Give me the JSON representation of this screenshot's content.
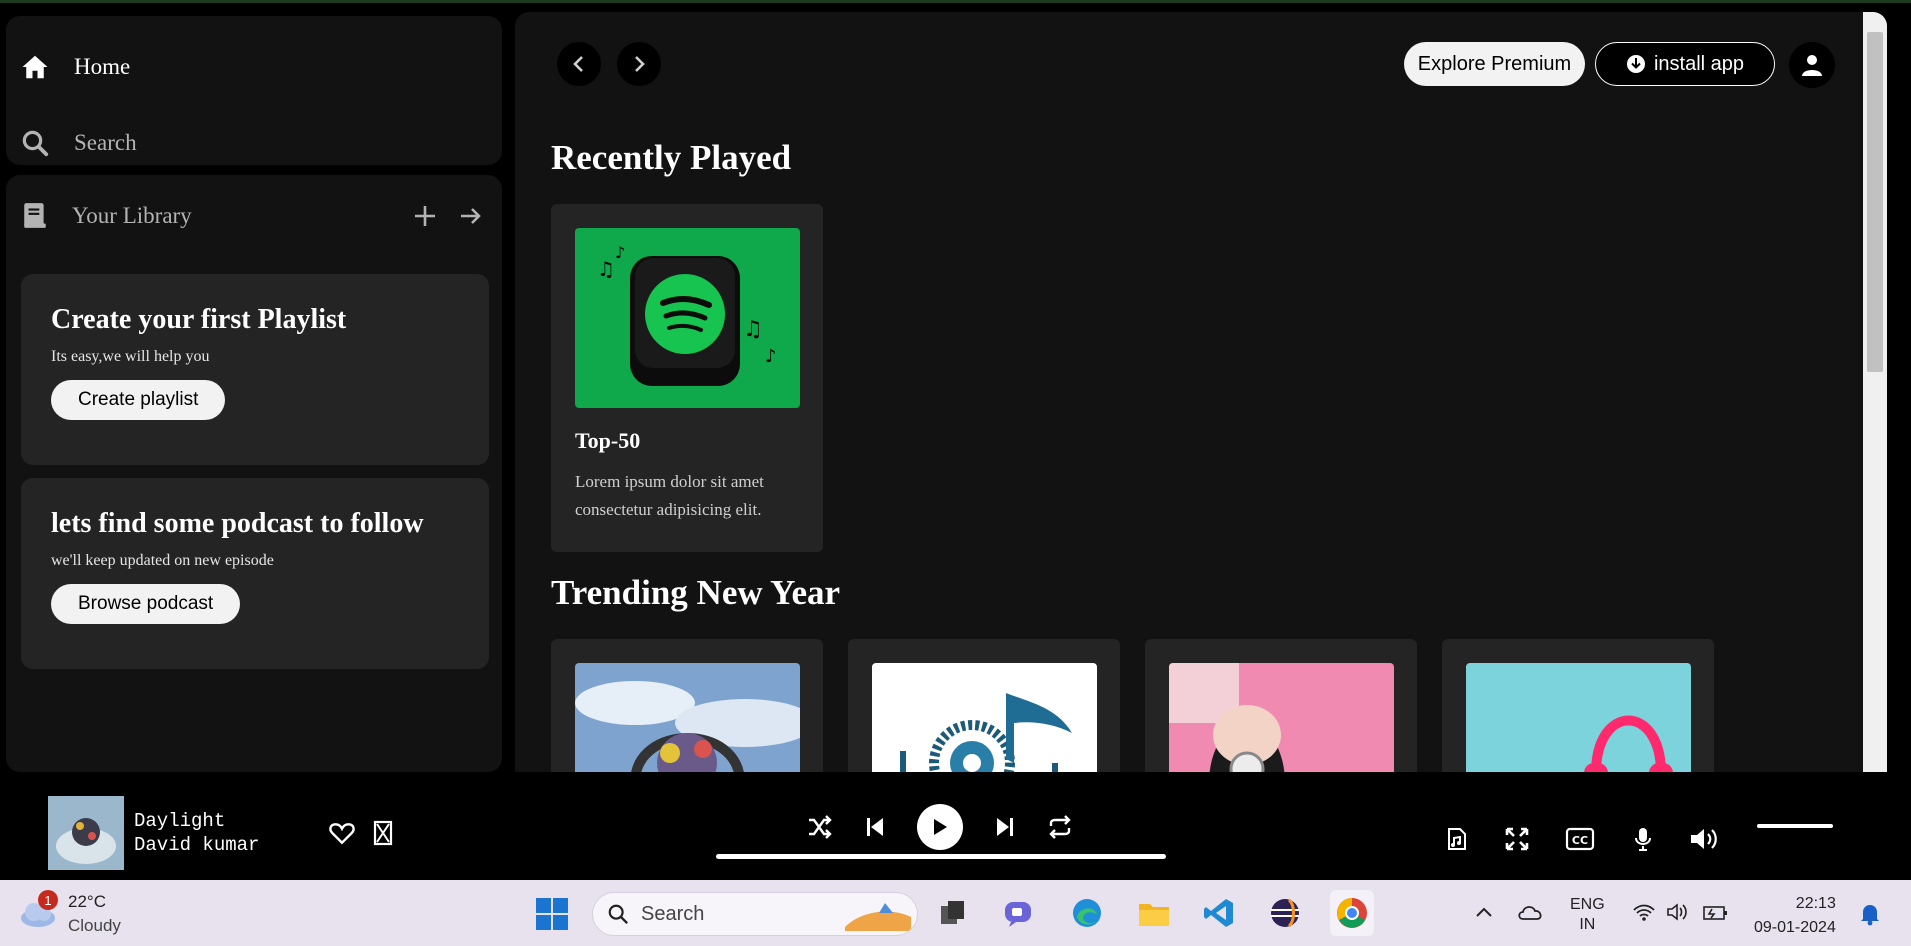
{
  "sidebar": {
    "home_label": "Home",
    "search_label": "Search",
    "library_label": "Your Library",
    "promo_playlist": {
      "title": "Create your first Playlist",
      "subtitle": "Its easy,we will help you",
      "button": "Create playlist"
    },
    "promo_podcast": {
      "title": "lets find some podcast to follow",
      "subtitle": "we'll keep updated on new episode",
      "button": "Browse podcast"
    }
  },
  "header": {
    "explore_label": "Explore Premium",
    "install_label": "install app"
  },
  "sections": {
    "recent_title": "Recently Played",
    "trending_title": "Trending New Year"
  },
  "recent_cards": [
    {
      "title": "Top-50",
      "description": "Lorem ipsum dolor sit amet consectetur adipisicing elit."
    }
  ],
  "player": {
    "track_title": "Daylight",
    "track_artist": "David kumar"
  },
  "taskbar": {
    "weather_temp": "22°C",
    "weather_desc": "Cloudy",
    "weather_badge": "1",
    "search_placeholder": "Search",
    "lang_line1": "ENG",
    "lang_line2": "IN",
    "time": "22:13",
    "date": "09-01-2024"
  },
  "colors": {
    "accent_green": "#1db954",
    "panel": "#121212",
    "card": "#242424"
  }
}
